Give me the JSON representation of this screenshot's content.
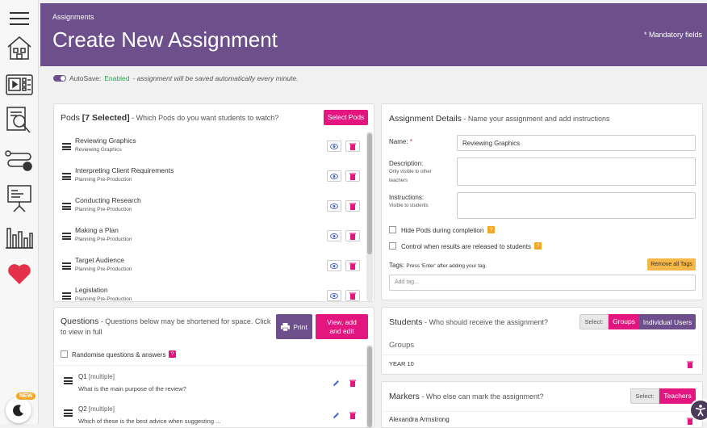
{
  "header": {
    "breadcrumb": "Assignments",
    "title": "Create New Assignment",
    "mandatory_note": "* Mandatory fields"
  },
  "sidebar": {
    "new_badge": "NEW",
    "icons": [
      "menu-icon",
      "home-icon",
      "video-library-icon",
      "search-document-icon",
      "pathway-icon",
      "presentation-icon",
      "analytics-icon",
      "heart-icon"
    ]
  },
  "autosave": {
    "label": "AutoSave:",
    "status": "Enabled",
    "note": " - assignment will be saved automatically every minute."
  },
  "pods": {
    "title": "Pods",
    "selected": "[7 Selected]",
    "subtitle": " - Which Pods do you want students to watch?",
    "select_button": "Select Pods",
    "items": [
      {
        "title": "Reviewing Graphics",
        "category": "Reviewing Graphics"
      },
      {
        "title": "Interpreting Client Requirements",
        "category": "Planning Pre-Production"
      },
      {
        "title": "Conducting Research",
        "category": "Planning Pre-Production"
      },
      {
        "title": "Making a Plan",
        "category": "Planning Pre-Production"
      },
      {
        "title": "Target Audience",
        "category": "Planning Pre-Production"
      },
      {
        "title": "Legislation",
        "category": "Planning Pre-Production"
      }
    ]
  },
  "details": {
    "title": "Assignment Details",
    "subtitle": " - Name your assignment and add instructions",
    "name_label": "Name:",
    "name_required": " *",
    "name_value": "Reviewing Graphics",
    "description_label": "Description:",
    "description_sub1": "Only visible to other",
    "description_sub2": "teachers",
    "instructions_label": "Instructions:",
    "instructions_sub": "Visible to students",
    "hide_pods": "Hide Pods during completion",
    "control_results": "Control when results are released to students",
    "help": "?",
    "tags_label": "Tags:",
    "tags_hint": "Press 'Enter' after adding your tag.",
    "remove_tags": "Remove all Tags",
    "tag_placeholder": "Add tag..."
  },
  "questions": {
    "title": "Questions",
    "subtitle": " - Questions below may be shortened for space. Click to view in full",
    "print": "Print",
    "view_edit": "View, add and edit",
    "randomise": "Randomise questions & answers",
    "help": "?",
    "items": [
      {
        "num": "Q1",
        "type": "[multiple]",
        "text": "What is the main purpose of the review?"
      },
      {
        "num": "Q2",
        "type": "[multiple]",
        "text": "Which of these is the best advice when suggesting ..."
      }
    ]
  },
  "students": {
    "title": "Students",
    "subtitle": " - Who should receive the assignment?",
    "select_label": "Select:",
    "groups_btn": "Groups",
    "individual_btn": "Individual Users",
    "groups_heading": "Groups",
    "group_item": "YEAR 10"
  },
  "markers": {
    "title": "Markers",
    "subtitle": " - Who else can mark the assignment?",
    "select_label": "Select:",
    "teachers_btn": "Teachers",
    "marker_item": "Alexandra Armstrong"
  },
  "colors": {
    "brand": "#6d4f8b",
    "accent": "#e3157e",
    "warning": "#f5a623"
  }
}
